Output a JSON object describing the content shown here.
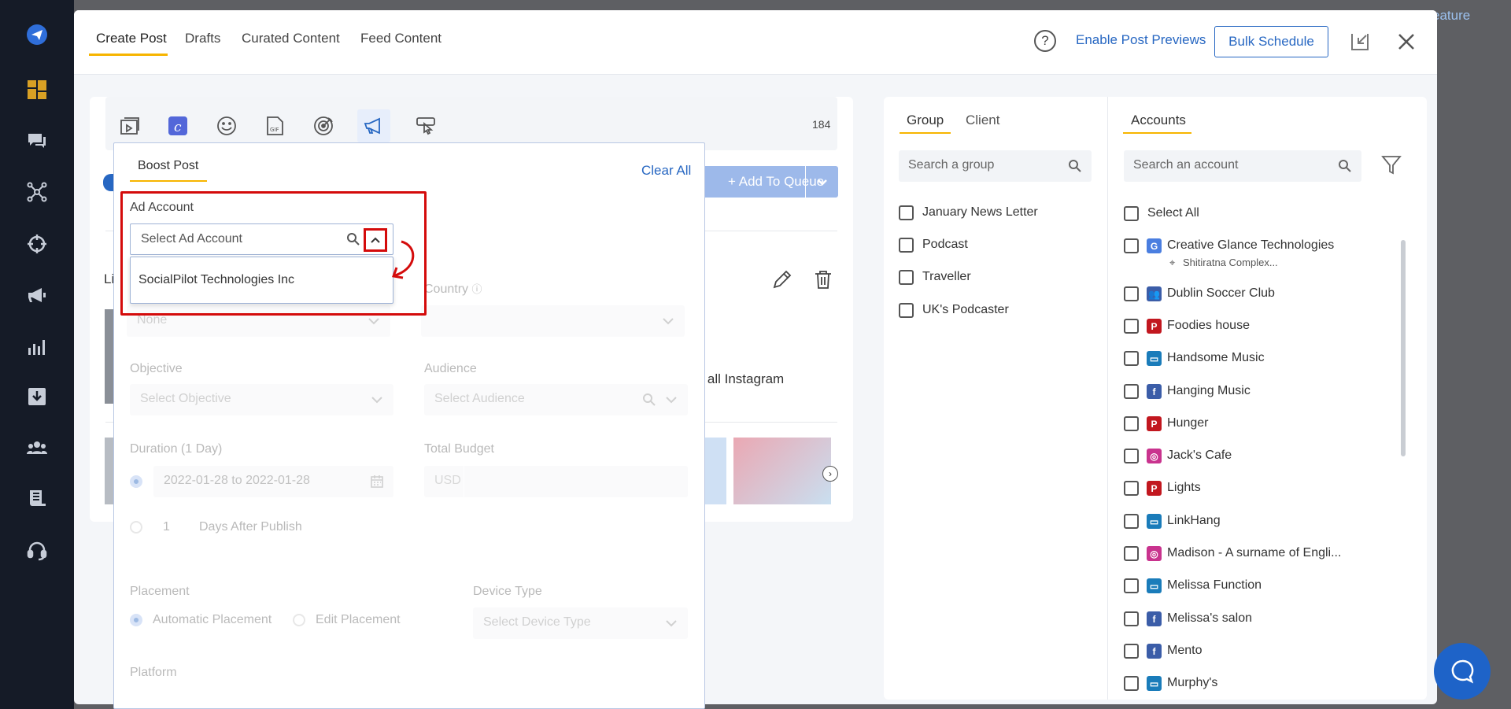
{
  "colors": {
    "accent": "#2767c2",
    "tab_underline": "#f7b500",
    "highlight": "#d40b0b",
    "sidebar": "#151b27"
  },
  "background": {
    "feature_link": "eature"
  },
  "sidebar": {
    "icons": [
      "paper-plane-icon",
      "dashboard-icon",
      "chat-icon",
      "network-icon",
      "crosshair-icon",
      "megaphone-icon",
      "bar-chart-icon",
      "download-icon",
      "team-icon",
      "document-icon",
      "headset-icon"
    ]
  },
  "header": {
    "tabs": [
      {
        "label": "Create Post"
      },
      {
        "label": "Drafts"
      },
      {
        "label": "Curated Content"
      },
      {
        "label": "Feed Content"
      }
    ],
    "help": "?",
    "enable_previews": "Enable Post Previews",
    "bulk_schedule": "Bulk Schedule"
  },
  "editor": {
    "char_count": "184",
    "add_to_queue": "Add To Queue",
    "queue_plus": "+",
    "obscured_label": "Li",
    "instagram_text": "et all Instagram"
  },
  "boost": {
    "tab": "Boost Post",
    "clear_all": "Clear All",
    "ad_account_label": "Ad Account",
    "ad_account_placeholder": "Select Ad Account",
    "ad_account_option": "SocialPilot Technologies Inc",
    "none_value": "None",
    "country_label": "Country",
    "objective_label": "Objective",
    "objective_placeholder": "Select Objective",
    "audience_label": "Audience",
    "audience_placeholder": "Select Audience",
    "duration_label": "Duration (1 Day)",
    "date_range": "2022-01-28 to 2022-01-28",
    "total_budget_label": "Total Budget",
    "currency": "USD",
    "days_value": "1",
    "days_after_publish": "Days After Publish",
    "placement_label": "Placement",
    "automatic_placement": "Automatic Placement",
    "edit_placement": "Edit Placement",
    "device_type_label": "Device Type",
    "device_type_placeholder": "Select Device Type",
    "platform_label": "Platform"
  },
  "groups": {
    "tabs": [
      {
        "label": "Group"
      },
      {
        "label": "Client"
      }
    ],
    "search_placeholder": "Search a group",
    "items": [
      {
        "label": "January News Letter"
      },
      {
        "label": "Podcast"
      },
      {
        "label": "Traveller"
      },
      {
        "label": "UK's Podcaster"
      }
    ]
  },
  "accounts": {
    "tab": "Accounts",
    "search_placeholder": "Search an account",
    "select_all": "Select All",
    "items": [
      {
        "label": "Creative Glance Technologies",
        "icon": "google-business-icon",
        "color": "#4a7ee0",
        "glyph": "G",
        "sub": "Shitiratna Complex..."
      },
      {
        "label": "Dublin Soccer Club",
        "icon": "facebook-group-icon",
        "color": "#3b5da8",
        "glyph": "👥"
      },
      {
        "label": "Foodies house",
        "icon": "pinterest-icon",
        "color": "#c2171f",
        "glyph": "P"
      },
      {
        "label": "Handsome Music",
        "icon": "linkedin-page-icon",
        "color": "#1a7cba",
        "glyph": "▭"
      },
      {
        "label": "Hanging Music",
        "icon": "facebook-icon",
        "color": "#3b5da8",
        "glyph": "f"
      },
      {
        "label": "Hunger",
        "icon": "pinterest-icon",
        "color": "#c2171f",
        "glyph": "P"
      },
      {
        "label": "Jack's Cafe",
        "icon": "instagram-icon",
        "color": "#c9338e",
        "glyph": "◎"
      },
      {
        "label": "Lights",
        "icon": "pinterest-icon",
        "color": "#c2171f",
        "glyph": "P"
      },
      {
        "label": "LinkHang",
        "icon": "linkedin-page-icon",
        "color": "#1a7cba",
        "glyph": "▭"
      },
      {
        "label": "Madison - A surname of Engli...",
        "icon": "instagram-icon",
        "color": "#c9338e",
        "glyph": "◎"
      },
      {
        "label": "Melissa Function",
        "icon": "linkedin-page-icon",
        "color": "#1a7cba",
        "glyph": "▭"
      },
      {
        "label": "Melissa's salon",
        "icon": "facebook-icon",
        "color": "#3b5da8",
        "glyph": "f"
      },
      {
        "label": "Mento",
        "icon": "facebook-icon",
        "color": "#3b5da8",
        "glyph": "f"
      },
      {
        "label": "Murphy's",
        "icon": "linkedin-page-icon",
        "color": "#1a7cba",
        "glyph": "▭"
      }
    ]
  }
}
